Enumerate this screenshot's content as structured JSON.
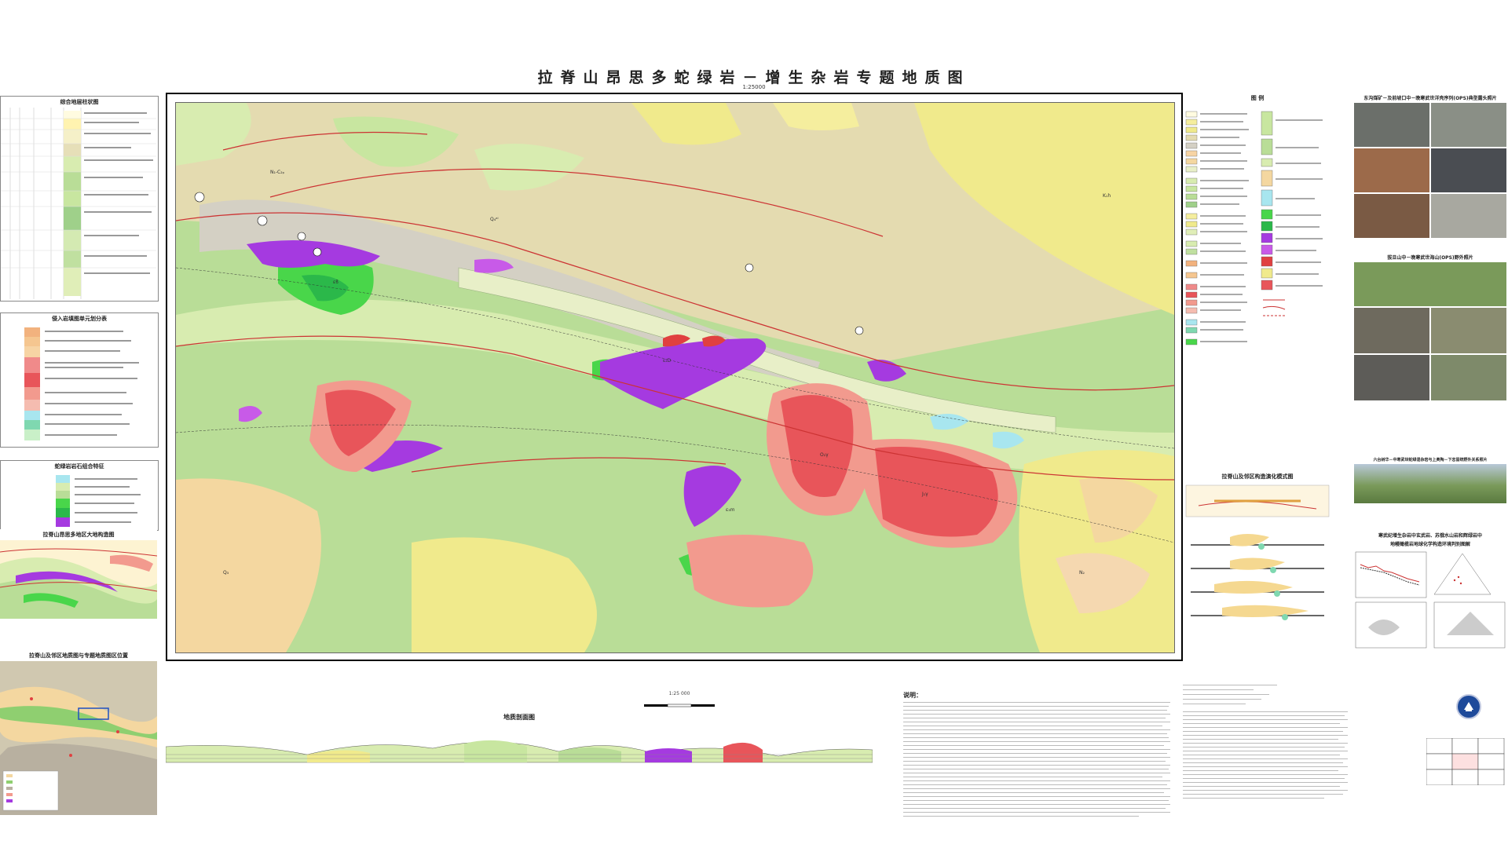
{
  "title": "拉脊山昂思多蛇绿岩－增生杂岩专题地质图",
  "scale_top": "1:25000",
  "left_panel": {
    "strat_title": "综合地层柱状图",
    "magma_title": "侵入岩填图单元划分表",
    "ophiolite_title": "蛇绿岩岩石组合特征",
    "sketch_title": "拉脊山昂思多地区大地构造图",
    "location_title": "拉脊山及邻区地质图与专题地质图区位置"
  },
  "right_legend": {
    "legend_title": "图 例",
    "evolution_title": "拉脊山及邻区构造演化模式图",
    "geochem_title_1": "寒武纪增生杂岩中玄武岩、苏俄水山岩和辉绿岩中",
    "geochem_title_2": "地幔橄榄岩地球化学构造环境判别图解"
  },
  "photos": {
    "title_1": "东沟煤矿－及前坡口中－晚寒武世洋壳序列(OPS)典型露头照片",
    "title_2": "拔旦山中－晚寒武世海山(OPS)野外照片",
    "title_3": "六台树华－中寒武世蛇绿混杂岩与上奥陶－下志留统野外关系照片"
  },
  "bottom": {
    "scale_bar": "1:25 000",
    "section_title": "地质剖面图",
    "notes_title": "说明："
  },
  "map_colors": {
    "base_green": "#b9dd97",
    "light_green": "#d8ecb0",
    "khaki": "#e4dbb0",
    "pale_yellow": "#f0ea8c",
    "gray": "#d4d0c4",
    "purple": "#a53ae0",
    "bright_green": "#49d64a",
    "red": "#e8555a",
    "salmon": "#f29a8e",
    "cyan": "#a8e6ef"
  },
  "map_labels": [
    "N₁-C₂ₚ",
    "Q₄ᵃˡ",
    "O₂γ",
    "ε₂D",
    "J₁γ",
    "K₁h",
    "εϐ",
    "Q₃",
    "N₂",
    "ε₃m"
  ]
}
